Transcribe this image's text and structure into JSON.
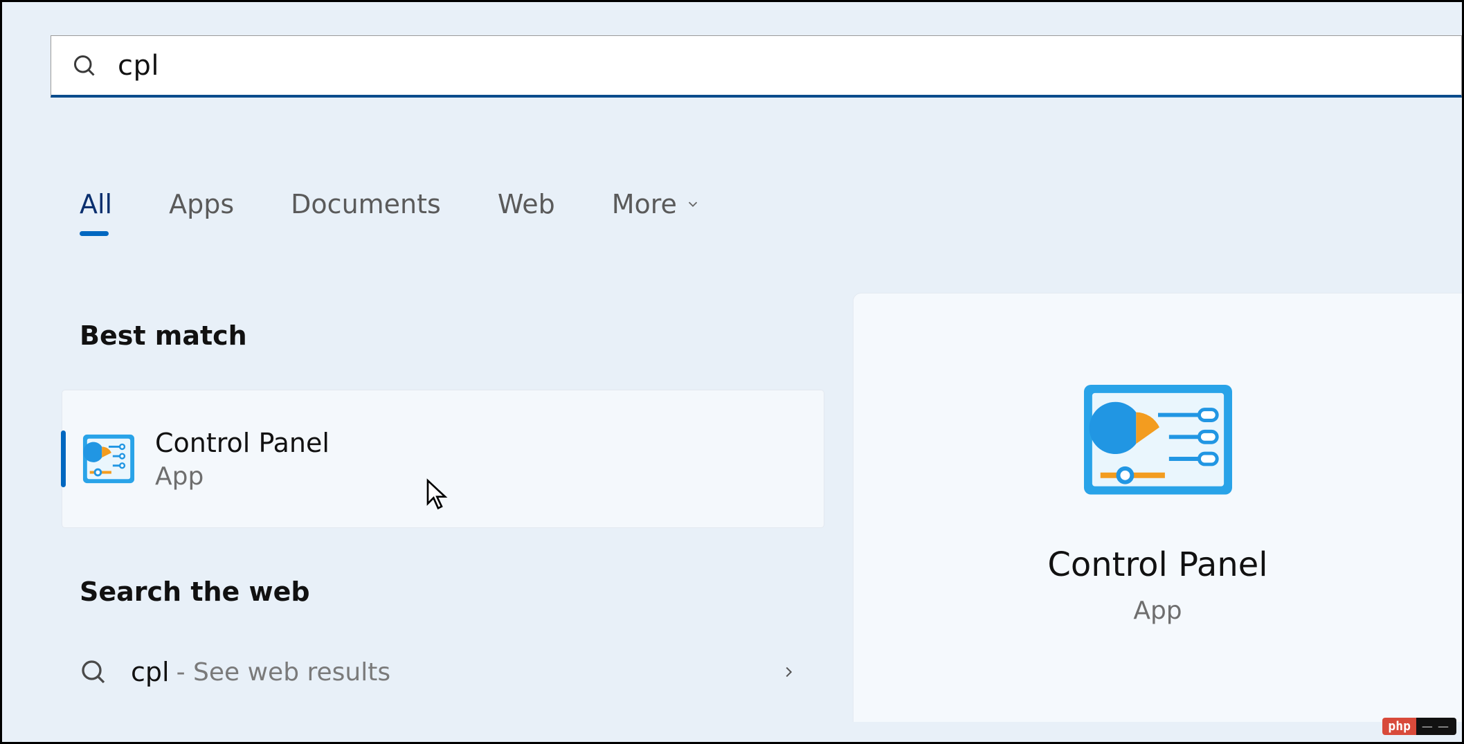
{
  "search": {
    "query": "cpl"
  },
  "filters": {
    "tabs": [
      "All",
      "Apps",
      "Documents",
      "Web",
      "More"
    ],
    "active_index": 0
  },
  "sections": {
    "best_match_title": "Best match",
    "search_web_title": "Search the web"
  },
  "best_match": {
    "title": "Control Panel",
    "subtitle": "App"
  },
  "web_result": {
    "query": "cpl",
    "hint": "- See web results"
  },
  "detail": {
    "title": "Control Panel",
    "subtitle": "App"
  },
  "watermark": {
    "left": "php",
    "right": "— —"
  }
}
